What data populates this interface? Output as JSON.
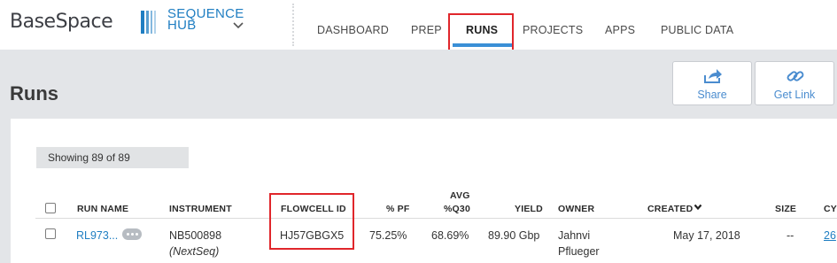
{
  "header": {
    "logo": "BaseSpace",
    "hub_line1": "SEQUENCE",
    "hub_line2": "HUB"
  },
  "nav": {
    "items": [
      {
        "label": "DASHBOARD"
      },
      {
        "label": "PREP"
      },
      {
        "label": "RUNS",
        "active": true
      },
      {
        "label": "PROJECTS"
      },
      {
        "label": "APPS"
      },
      {
        "label": "PUBLIC DATA"
      }
    ]
  },
  "page": {
    "title": "Runs",
    "share_label": "Share",
    "get_link_label": "Get Link"
  },
  "table": {
    "showing": "Showing 89 of 89",
    "headers": {
      "run_name": "RUN NAME",
      "instrument": "INSTRUMENT",
      "flowcell": "FLOWCELL ID",
      "pf": "% PF",
      "q30_line1": "AVG",
      "q30_line2": "%Q30",
      "yield": "YIELD",
      "owner": "OWNER",
      "created": "CREATED",
      "size": "SIZE",
      "cy": "CY"
    },
    "rows": [
      {
        "run_name": "RL973...",
        "instrument": "NB500898",
        "instrument_type": "(NextSeq)",
        "flowcell": "HJ57GBGX5",
        "pf": "75.25%",
        "q30": "68.69%",
        "yield": "89.90 Gbp",
        "owner_line1": "Jahnvi",
        "owner_line2": "Pflueger",
        "created": "May 17, 2018",
        "size": "--",
        "cy": "26"
      }
    ]
  },
  "colors": {
    "accent": "#1f7ec2",
    "highlight": "#e0262b",
    "band": "#e3e5e8"
  },
  "icons": [
    "hub-logo-icon",
    "chevron-down-icon",
    "share-icon",
    "link-icon",
    "more-icon",
    "sort-desc-icon"
  ]
}
